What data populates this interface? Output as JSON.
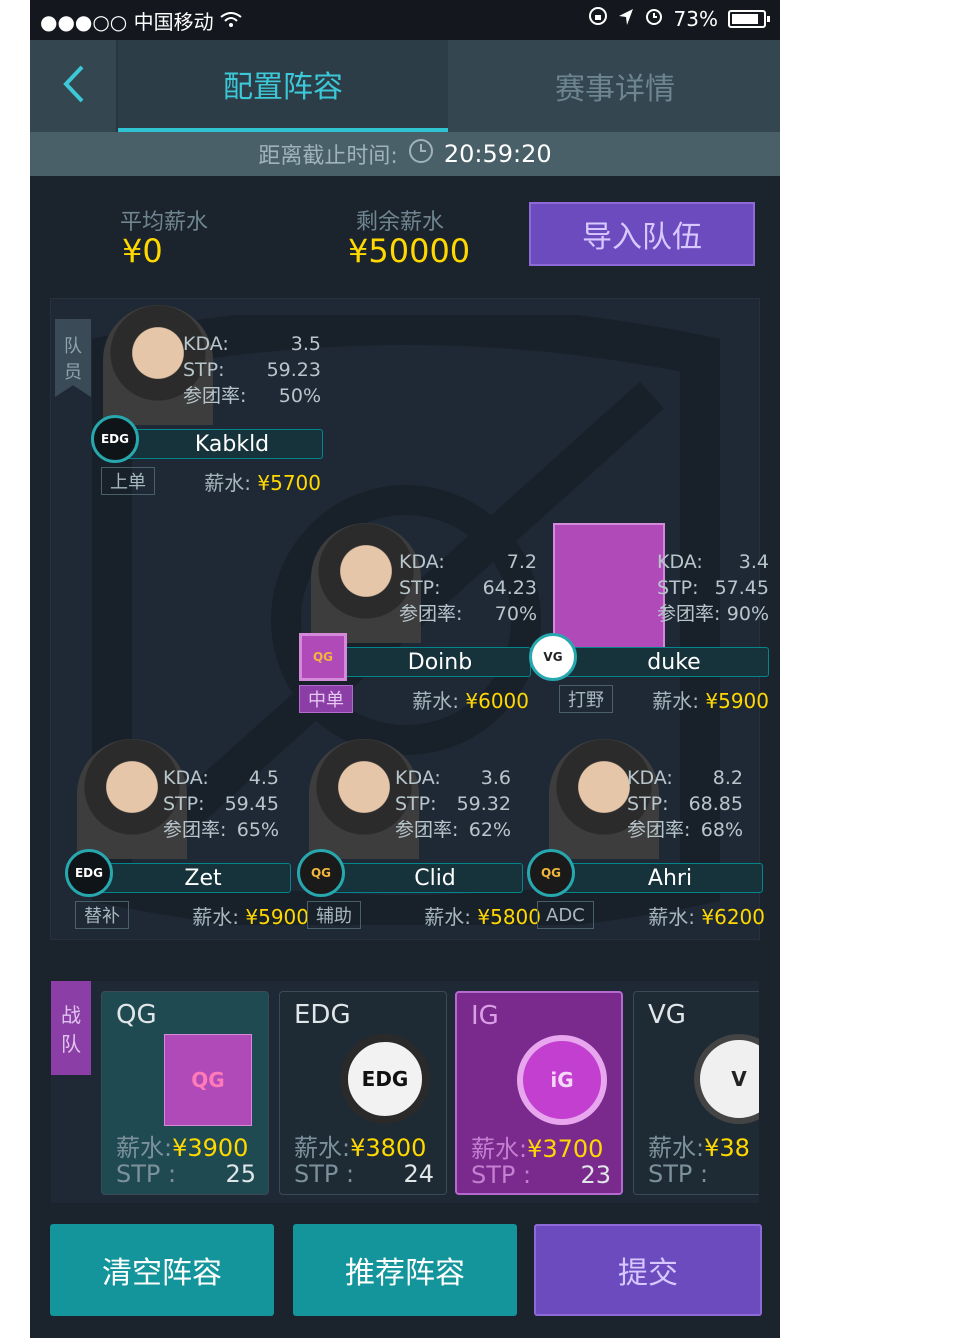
{
  "statusbar": {
    "carrier": "●●●○○ 中国移动",
    "battery": "73%"
  },
  "nav": {
    "tab_config": "配置阵容",
    "tab_details": "赛事详情"
  },
  "deadline": {
    "label": "距离截止时间:",
    "time": "20:59:20"
  },
  "salary": {
    "avg_label": "平均薪水",
    "avg_value": "¥0",
    "remain_label": "剩余薪水",
    "remain_value": "¥50000",
    "import_button": "导入队伍"
  },
  "team_tag": [
    "队",
    "员"
  ],
  "players": [
    {
      "name": "Kabkld",
      "kda": "3.5",
      "stp": "59.23",
      "participation": "50%",
      "role": "上单",
      "salary": "¥5700",
      "team_logo": "EDG"
    },
    {
      "name": "Doinb",
      "kda": "7.2",
      "stp": "64.23",
      "participation": "70%",
      "role": "中单",
      "salary": "¥6000",
      "team_logo": "QG"
    },
    {
      "name": "duke",
      "kda": "3.4",
      "stp": "57.45",
      "participation": "90%",
      "role": "打野",
      "salary": "¥5900",
      "team_logo": "VG"
    },
    {
      "name": "Zet",
      "kda": "4.5",
      "stp": "59.45",
      "participation": "65%",
      "role": "替补",
      "salary": "¥5900",
      "team_logo": "EDG"
    },
    {
      "name": "Clid",
      "kda": "3.6",
      "stp": "59.32",
      "participation": "62%",
      "role": "辅助",
      "salary": "¥5800",
      "team_logo": "QG"
    },
    {
      "name": "Ahri",
      "kda": "8.2",
      "stp": "68.85",
      "participation": "68%",
      "role": "ADC",
      "salary": "¥6200",
      "team_logo": "QG"
    }
  ],
  "stat_labels": {
    "kda": "KDA:",
    "stp": "STP:",
    "participation": "参团率:",
    "salary": "薪水:"
  },
  "teams_tag": [
    "战",
    "队"
  ],
  "teams": [
    {
      "name": "QG",
      "salary": "¥3900",
      "stp": "25"
    },
    {
      "name": "EDG",
      "salary": "¥3800",
      "stp": "24"
    },
    {
      "name": "IG",
      "salary": "¥3700",
      "stp": "23"
    },
    {
      "name": "VG",
      "salary": "¥38",
      "stp": ""
    }
  ],
  "team_labels": {
    "salary": "薪水:",
    "stp": "STP :"
  },
  "buttons": {
    "clear": "清空阵容",
    "recommend": "推荐阵容",
    "submit": "提交"
  }
}
